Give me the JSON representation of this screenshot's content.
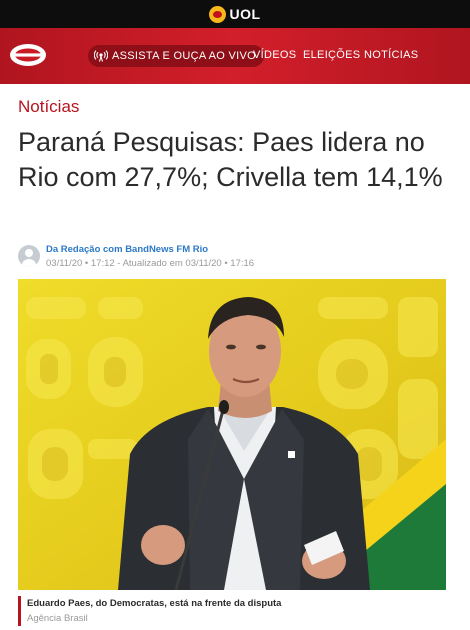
{
  "topbar": {
    "brand": "UOL"
  },
  "nav": {
    "live_label": "ASSISTA E OUÇA AO VIVO",
    "links": [
      "VÍDEOS",
      "ELEIÇÕES",
      "NOTÍCIAS"
    ]
  },
  "article": {
    "section": "Notícias",
    "headline": "Paraná Pesquisas: Paes lidera no Rio com 27,7%; Crivella tem 14,1%",
    "author": "Da Redação com BandNews FM Rio",
    "dates": "03/11/20 • 17:12 - Atualizado em 03/11/20 • 17:16"
  },
  "photo": {
    "caption": "Eduardo Paes, do Democratas, está na frente da disputa",
    "credit": "Agência Brasil"
  },
  "colors": {
    "accent": "#b8141f",
    "nav_red": "#d21f2b",
    "link_blue": "#2c7ac9",
    "backdrop_yellow": "#e9d21e"
  }
}
